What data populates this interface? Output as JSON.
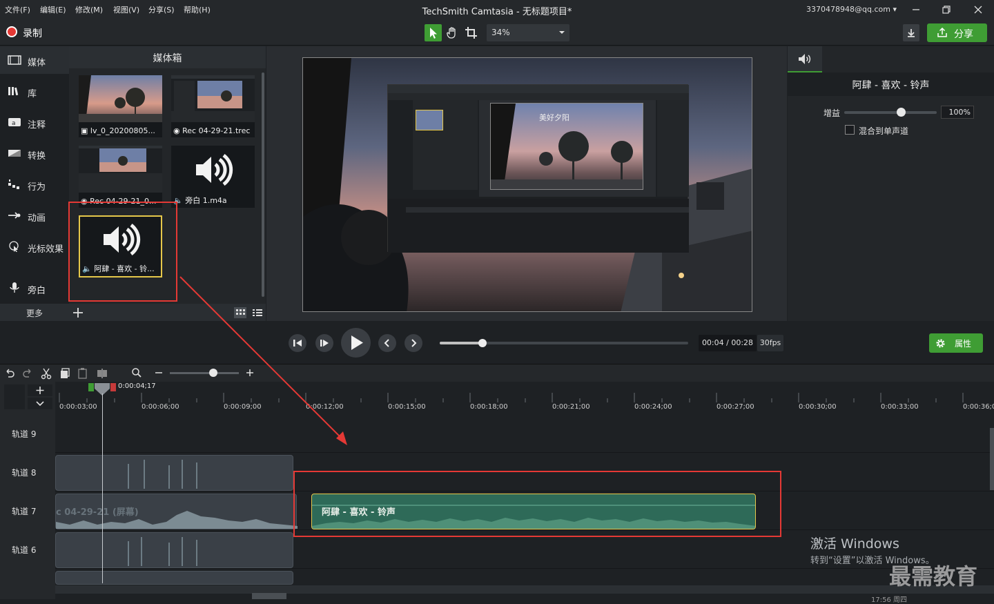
{
  "menu": [
    "文件(F)",
    "编辑(E)",
    "修改(M)",
    "视图(V)",
    "分享(S)",
    "帮助(H)"
  ],
  "window": {
    "title": "TechSmith Camtasia - 无标题项目*",
    "account": "3370478948@qq.com"
  },
  "toolbar": {
    "record_label": "录制",
    "zoom": "34%",
    "share_label": "分享"
  },
  "nav": {
    "items": [
      "媒体",
      "库",
      "注释",
      "转换",
      "行为",
      "动画",
      "光标效果",
      "旁白"
    ],
    "more": "更多"
  },
  "media_bin": {
    "title": "媒体箱",
    "items": [
      {
        "name": "lv_0_20200805...",
        "kind": "video"
      },
      {
        "name": "Rec 04-29-21.trec",
        "kind": "recording"
      },
      {
        "name": "Rec 04-29-21_0...",
        "kind": "recording"
      },
      {
        "name": "旁白 1.m4a",
        "kind": "audio"
      },
      {
        "name": "阿肆 - 喜欢 - 铃...",
        "kind": "audio"
      }
    ]
  },
  "preview": {
    "nested_caption": "美好夕阳"
  },
  "properties": {
    "clip_title": "阿肆 - 喜欢 - 铃声",
    "gain_label": "增益",
    "gain_value": "100%",
    "gain_level": 0.57,
    "mono_label": "混合到单声道",
    "properties_button": "属性"
  },
  "playback": {
    "time": "00:04 / 00:28",
    "fps": "30fps",
    "progress": 0.17
  },
  "timeline": {
    "playhead": "0:00:04;17",
    "ticks": [
      "0:00:03;00",
      "0:00:06;00",
      "0:00:09;00",
      "0:00:12;00",
      "0:00:15;00",
      "0:00:18;00",
      "0:00:21;00",
      "0:00:24;00",
      "0:00:27;00",
      "0:00:30;00",
      "0:00:33;00",
      "0:00:36;0"
    ],
    "tracks": [
      "轨道 9",
      "轨道 8",
      "轨道 7",
      "轨道 6"
    ],
    "clip7_label": "c 04-29-21 (屏幕)",
    "bell_clip_label": "阿肆 - 喜欢 - 铃声"
  },
  "watermark": {
    "title": "激活 Windows",
    "subtitle": "转到“设置”以激活 Windows。",
    "brand": "最需教育",
    "clock": "17:56 周四"
  },
  "colors": {
    "accent_green": "#3f9d34",
    "record_red": "#e53935",
    "annotation_red": "#e53935",
    "clip_highlight": "#e6c84a"
  }
}
